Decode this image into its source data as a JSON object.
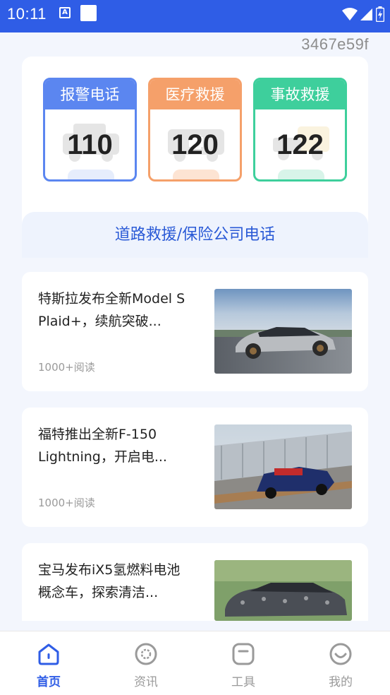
{
  "status_bar": {
    "time": "10:11",
    "notif_letter": "A"
  },
  "code_tag": "3467e59f",
  "emergency": [
    {
      "label": "报警电话",
      "number": "110",
      "color": "#5b86f0"
    },
    {
      "label": "医疗救援",
      "number": "120",
      "color": "#f5a06a"
    },
    {
      "label": "事故救援",
      "number": "122",
      "color": "#3ecf9c"
    }
  ],
  "road_rescue_label": "道路救援/保险公司电话",
  "news": [
    {
      "title": "特斯拉发布全新Model S Plaid+，续航突破...",
      "meta": "1000+阅读"
    },
    {
      "title": "福特推出全新F-150 Lightning，开启电...",
      "meta": "1000+阅读"
    },
    {
      "title": "宝马发布iX5氢燃料电池概念车，探索清洁...",
      "meta": ""
    }
  ],
  "nav": [
    {
      "label": "首页",
      "icon": "home-icon",
      "active": true
    },
    {
      "label": "资讯",
      "icon": "news-icon",
      "active": false
    },
    {
      "label": "工具",
      "icon": "tools-icon",
      "active": false
    },
    {
      "label": "我的",
      "icon": "profile-icon",
      "active": false
    }
  ],
  "colors": {
    "primary": "#2f5de6",
    "police": "#5b86f0",
    "medical": "#f5a06a",
    "accident": "#3ecf9c"
  }
}
